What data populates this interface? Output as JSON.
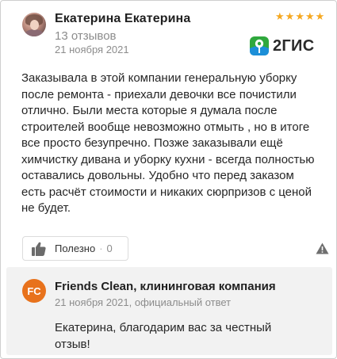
{
  "review": {
    "author_name": "Екатерина Екатерина",
    "reviews_count": "13 отзывов",
    "date": "21 ноября 2021",
    "rating": 5,
    "stars": [
      "★",
      "★",
      "★",
      "★",
      "★"
    ],
    "text": "Заказывала в этой компании генеральную уборку после ремонта - приехали девочки все почистили отлично. Были места которые я думала после строителей вообще невозможно отмыть , но в итоге все просто безупречно. Позже заказывали ещё химчистку дивана и уборку кухни - всегда полностью оставались довольны. Удобно что перед заказом есть расчёт стоимости и никаких сюрпризов с ценой не будет."
  },
  "source": {
    "logo_text": "2ГИС",
    "logo_icon": "2gis-logo-icon"
  },
  "actions": {
    "useful_label": "Полезно",
    "separator": "·",
    "useful_count": "0",
    "thumb_icon": "thumbs-up-icon",
    "complaint_icon": "warning-icon"
  },
  "reply": {
    "badge": "FC",
    "company_name": "Friends Clean, клининговая компания",
    "meta": "21 ноября 2021, официальный ответ",
    "text": "Екатерина, благодарим вас за честный отзыв!"
  },
  "colors": {
    "star": "#f6a820",
    "logo_green": "#2fa83d",
    "logo_blue": "#1c8fd8",
    "badge_orange": "#e8721c",
    "reply_bg": "#f2f2f2",
    "muted_text": "#8c8c8c"
  }
}
